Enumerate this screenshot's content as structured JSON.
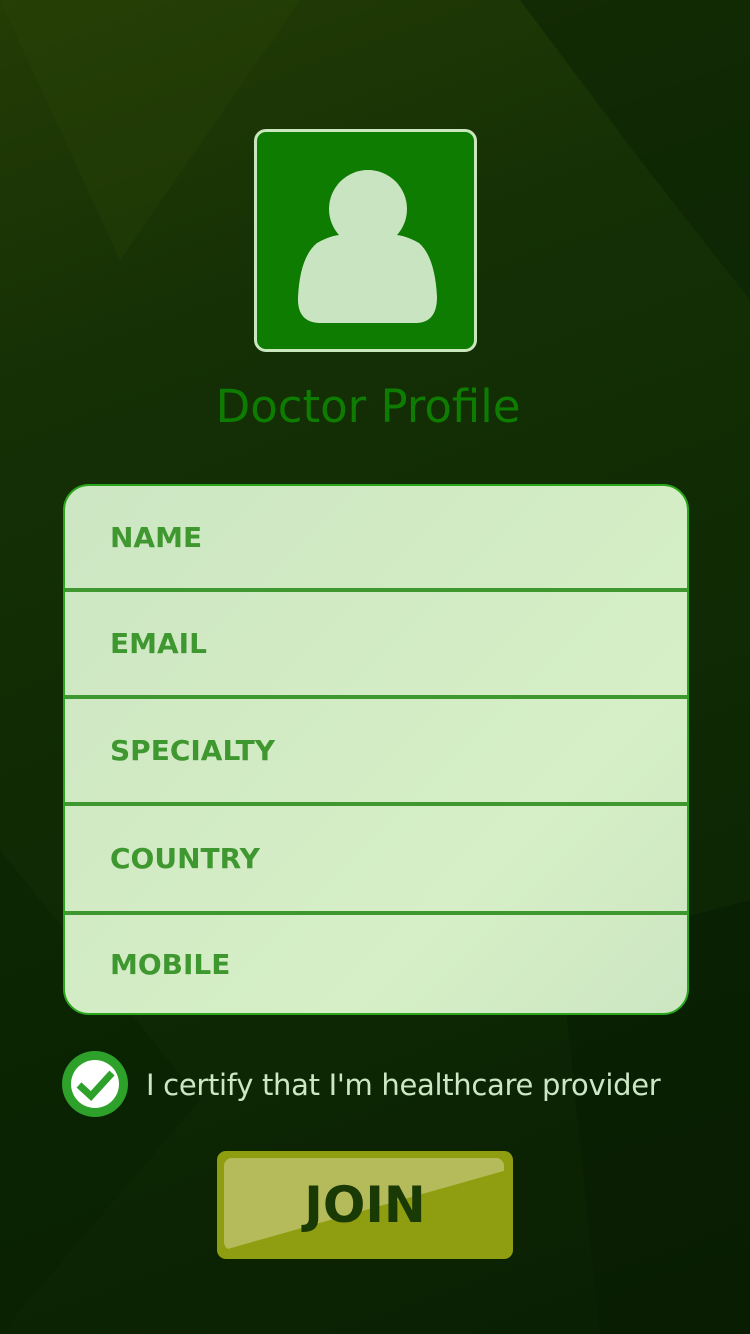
{
  "header": {
    "title": "Doctor Profile",
    "avatar_icon": "user-silhouette-icon"
  },
  "form": {
    "fields": [
      {
        "name": "name",
        "placeholder": "NAME",
        "value": ""
      },
      {
        "name": "email",
        "placeholder": "EMAIL",
        "value": ""
      },
      {
        "name": "specialty",
        "placeholder": "SPECIALTY",
        "value": ""
      },
      {
        "name": "country",
        "placeholder": "COUNTRY",
        "value": ""
      },
      {
        "name": "mobile",
        "placeholder": "MOBILE",
        "value": ""
      }
    ]
  },
  "certify": {
    "label": "I certify that I'm healthcare provider",
    "checked": true
  },
  "join": {
    "label": "JOIN"
  },
  "colors": {
    "accent": "#0e7c00",
    "field_text": "#3f9730",
    "button": "#8f9e10",
    "check": "#2ea12a"
  }
}
